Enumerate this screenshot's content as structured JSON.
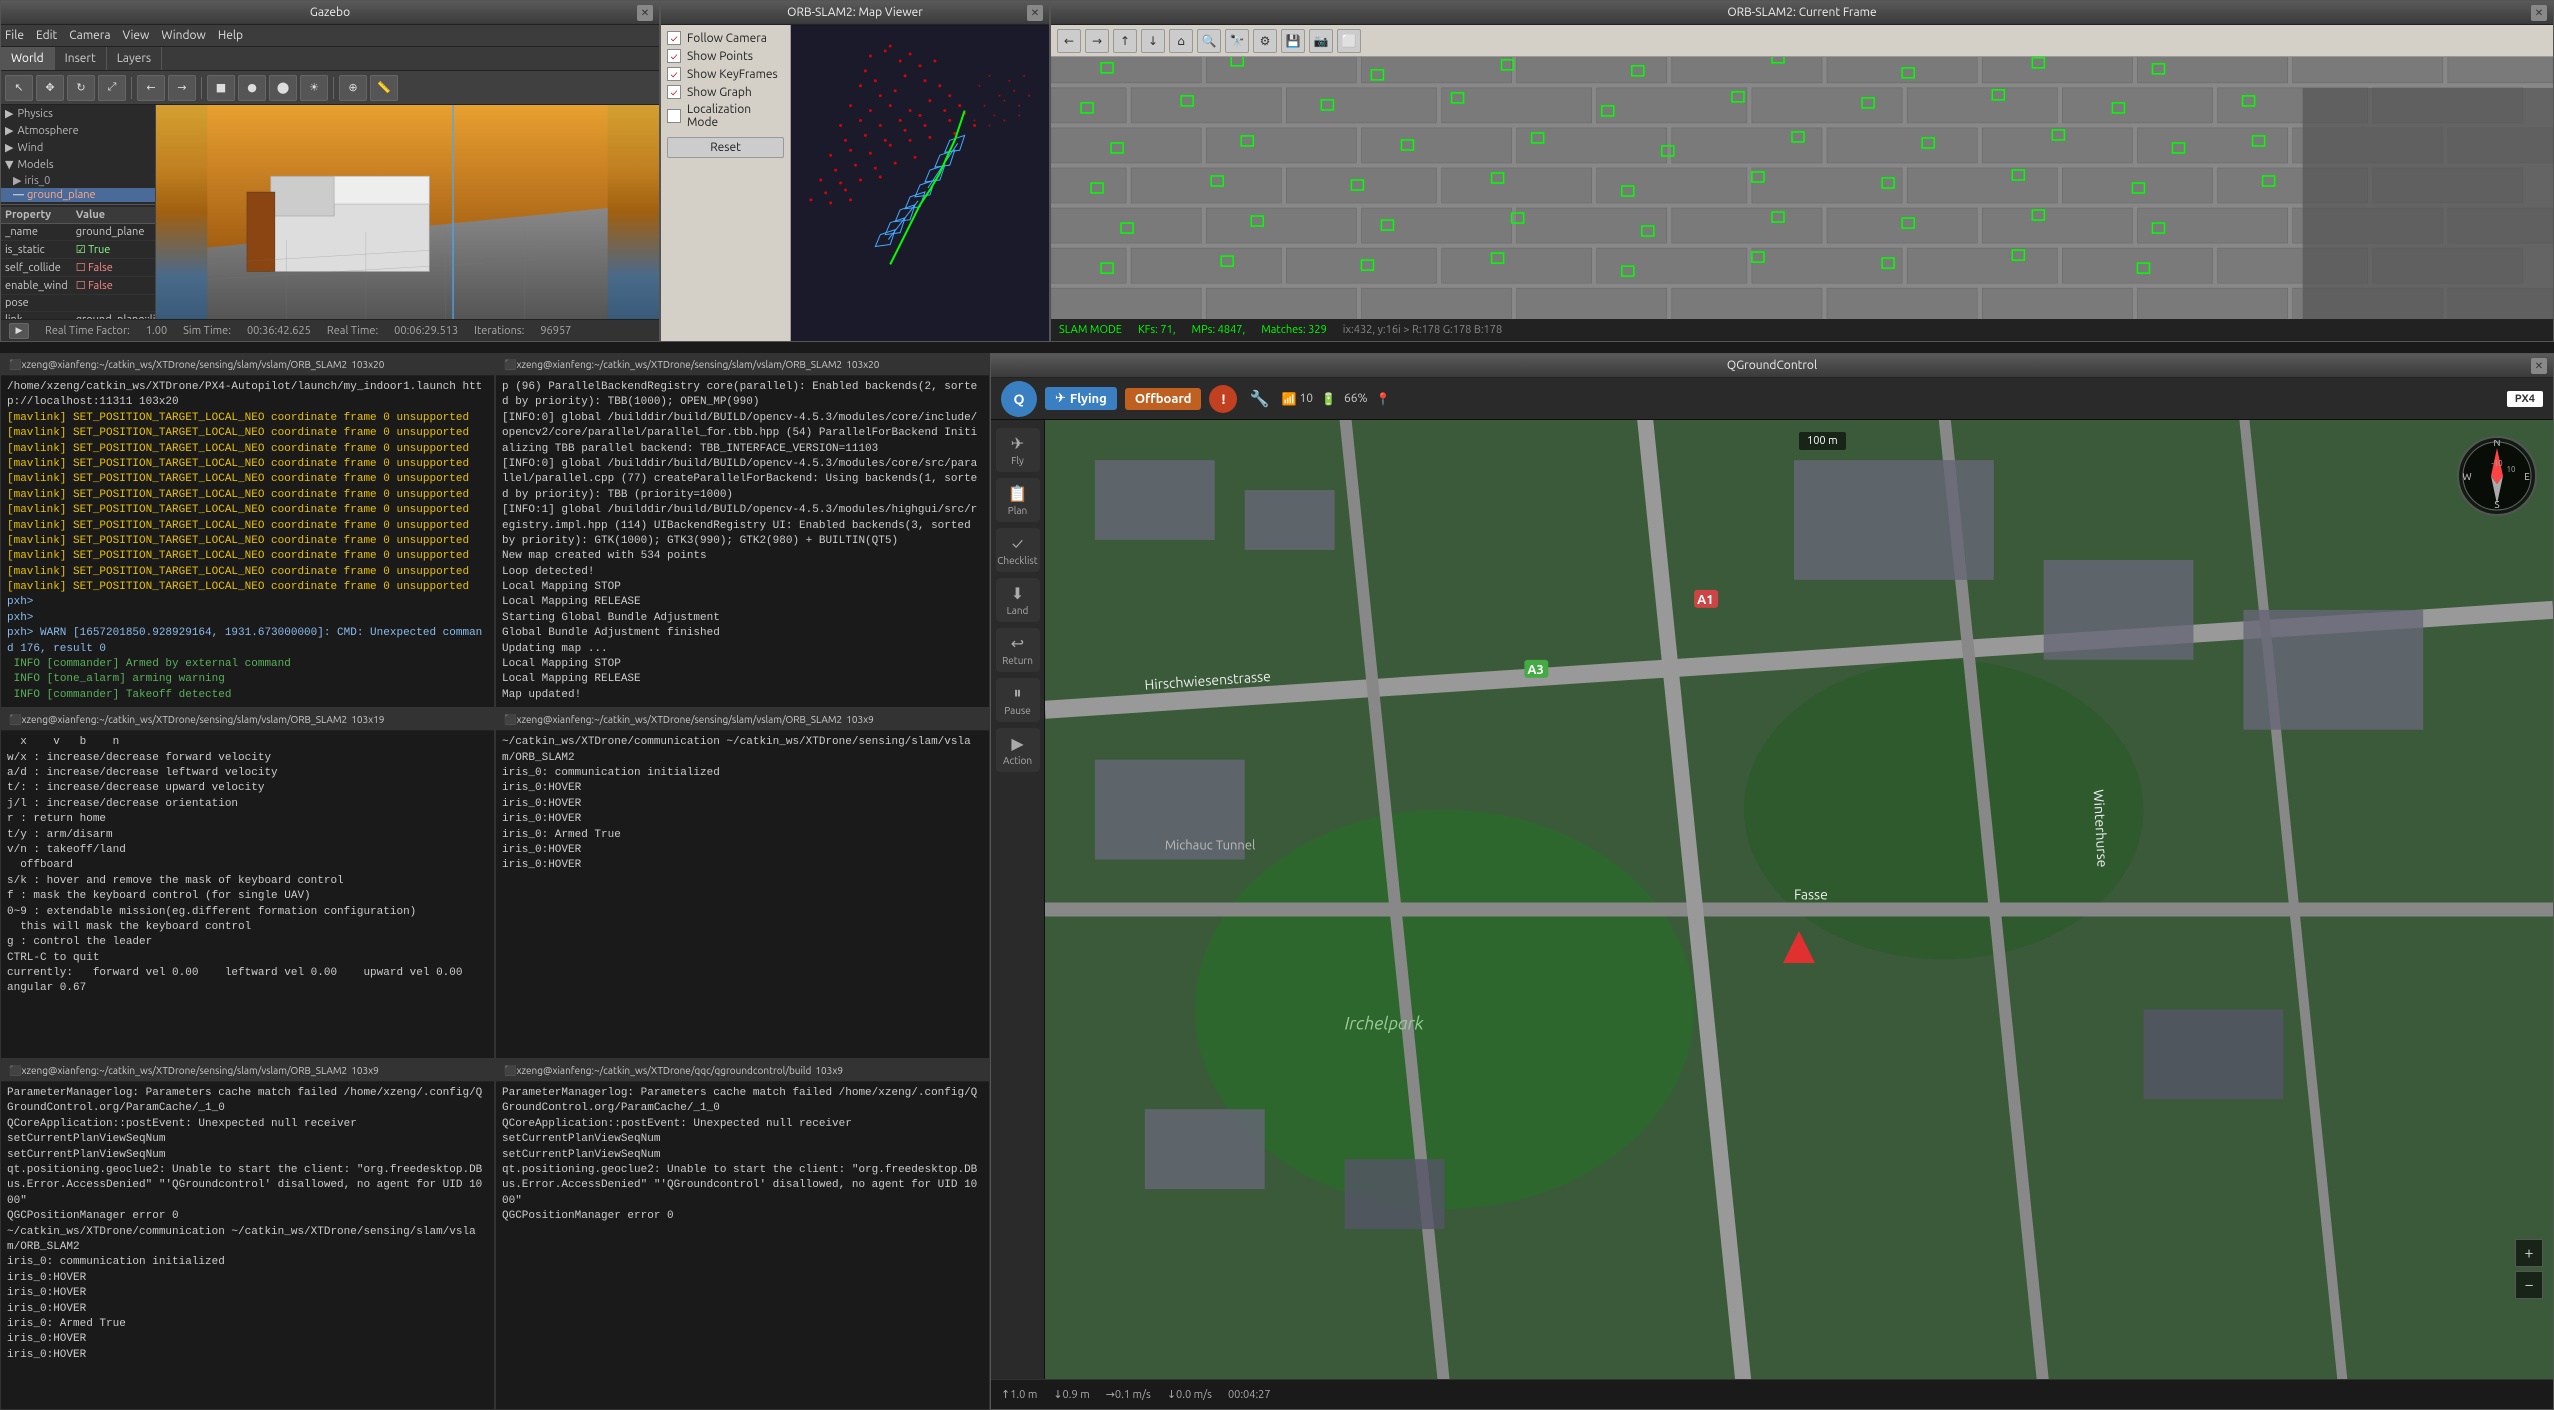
{
  "gazebo": {
    "title": "Gazebo",
    "menu": [
      "File",
      "Edit",
      "Camera",
      "View",
      "Window",
      "Help"
    ],
    "tabs": [
      "World",
      "Insert",
      "Layers"
    ],
    "active_tab": "World",
    "sidebar": {
      "sections": [
        {
          "label": "Physics",
          "expanded": false
        },
        {
          "label": "Atmosphere",
          "expanded": false
        },
        {
          "label": "Wind",
          "expanded": false
        },
        {
          "label": "Models",
          "expanded": true
        }
      ],
      "models": [
        {
          "label": "iris_0",
          "indent": 1
        },
        {
          "label": "ground_plane",
          "indent": 2,
          "selected": true
        }
      ]
    },
    "properties": {
      "headers": [
        "Property",
        "Value"
      ],
      "rows": [
        {
          "property": "_name",
          "value": "ground_plane"
        },
        {
          "property": "is_static",
          "value": "True"
        },
        {
          "property": "self_collide",
          "value": "False"
        },
        {
          "property": "enable_wind",
          "value": "False"
        },
        {
          "property": "pose",
          "value": ""
        },
        {
          "property": "link",
          "value": "ground_plane::link"
        }
      ]
    },
    "status": {
      "real_time_factor_label": "Real Time Factor:",
      "real_time_factor": "1.00",
      "sim_time_label": "Sim Time:",
      "sim_time": "00:36:42.625",
      "real_time_label": "Real Time:",
      "real_time": "00:06:29.513",
      "iterations_label": "Iterations:",
      "iterations": "96957"
    }
  },
  "orbslam_map": {
    "title": "ORB-SLAM2: Map Viewer",
    "checkboxes": [
      {
        "label": "Follow Camera",
        "checked": true
      },
      {
        "label": "Show Points",
        "checked": true
      },
      {
        "label": "Show KeyFrames",
        "checked": true
      },
      {
        "label": "Show Graph",
        "checked": true
      },
      {
        "label": "Localization Mode",
        "checked": false
      }
    ],
    "reset_label": "Reset"
  },
  "orbslam_frame": {
    "title": "ORB-SLAM2: Current Frame",
    "toolbar_buttons": [
      "←",
      "→",
      "↑",
      "↓",
      "⊡",
      "🔍+",
      "🔍-",
      "⚙",
      "💾",
      "📋",
      "🔲"
    ],
    "status": {
      "slam_mode": "SLAM MODE",
      "kfs": "KFs: 71,",
      "mps": "MPs: 4847,",
      "matches": "Matches: 329",
      "coords": "ix:432, y:16i > R:178 G:178 B:178"
    }
  },
  "terminals": [
    {
      "id": "term1",
      "title": "xzeng@xianfeng:~/catkin_ws/XTDrone/sensing/slam/vslam/ORB_SLAM2",
      "size": "103x20",
      "lines": [
        {
          "type": "normal",
          "text": "/home/xzeng/catkin_ws/XTDrone/PX4-Autopilot/launch/my_indoor1.launch http://localhost:11311 103x20"
        },
        {
          "type": "warn",
          "text": "[mavlink] SET_POSITION_TARGET_LOCAL_NEO coordinate frame 0 unsupported"
        },
        {
          "type": "warn",
          "text": "[mavlink] SET_POSITION_TARGET_LOCAL_NEO coordinate frame 0 unsupported"
        },
        {
          "type": "warn",
          "text": "[mavlink] SET_POSITION_TARGET_LOCAL_NEO coordinate frame 0 unsupported"
        },
        {
          "type": "warn",
          "text": "[mavlink] SET_POSITION_TARGET_LOCAL_NEO coordinate frame 0 unsupported"
        },
        {
          "type": "warn",
          "text": "[mavlink] SET_POSITION_TARGET_LOCAL_NEO coordinate frame 0 unsupported"
        },
        {
          "type": "warn",
          "text": "[mavlink] SET_POSITION_TARGET_LOCAL_NEO coordinate frame 0 unsupported"
        },
        {
          "type": "warn",
          "text": "[mavlink] SET_POSITION_TARGET_LOCAL_NEO coordinate frame 0 unsupported"
        },
        {
          "type": "warn",
          "text": "[mavlink] SET_POSITION_TARGET_LOCAL_NEO coordinate frame 0 unsupported"
        },
        {
          "type": "warn",
          "text": "[mavlink] SET_POSITION_TARGET_LOCAL_NEO coordinate frame 0 unsupported"
        },
        {
          "type": "warn",
          "text": "[mavlink] SET_POSITION_TARGET_LOCAL_NEO coordinate frame 0 unsupported"
        },
        {
          "type": "warn",
          "text": "[mavlink] SET_POSITION_TARGET_LOCAL_NEO coordinate frame 0 unsupported"
        },
        {
          "type": "warn",
          "text": "[mavlink] SET_POSITION_TARGET_LOCAL_NEO coordinate frame 0 unsupported"
        },
        {
          "type": "prompt",
          "text": "pxh>"
        },
        {
          "type": "prompt",
          "text": "pxh>"
        },
        {
          "type": "prompt",
          "text": "pxh> WARN [1657201850.928929164, 1931.673000000]: CMD: Unexpected command 176, result 0"
        },
        {
          "type": "info",
          "text": " INFO [commander] Armed by external command"
        },
        {
          "type": "info",
          "text": " INFO [tone_alarm] arming warning"
        },
        {
          "type": "info",
          "text": " INFO [commander] Takeoff detected"
        }
      ]
    },
    {
      "id": "term2",
      "title": "xzeng@xianfeng:~/catkin_ws/XTDrone/sensing/slam/vslam/ORB_SLAM2",
      "size": "103x20",
      "lines": [
        {
          "type": "normal",
          "text": "p (96) ParallelBackendRegistry core(parallel): Enabled backends(2, sorted by priority): TBB(1000); OPEN_MP(990)"
        },
        {
          "type": "normal",
          "text": "[INFO:0] global /builddir/build/BUILD/opencv-4.5.3/modules/core/include/opencv2/core/parallel/parallel_for.tbb.hpp (54) ParallelForBackend Initializing TBB parallel backend: TBB_INTERFACE_VERSION=11103"
        },
        {
          "type": "normal",
          "text": "[INFO:0] global /builddir/build/BUILD/opencv-4.5.3/modules/core/src/parallel/parallel.cpp (77) createParallelForBackend: Using backends(1, sorted by priority): TBB (priority=1000)"
        },
        {
          "type": "normal",
          "text": "[INFO:1] global /builddir/build/BUILD/opencv-4.5.3/modules/highgui/src/registry.impl.hpp (114) UIBackendRegistry UI: Enabled backends(3, sorted by priority): GTK(1000); GTK3(990); GTK2(980) + BUILTIN(QT5)"
        },
        {
          "type": "normal",
          "text": "New map created with 534 points"
        },
        {
          "type": "normal",
          "text": "Loop detected!"
        },
        {
          "type": "normal",
          "text": "Local Mapping STOP"
        },
        {
          "type": "normal",
          "text": "Local Mapping RELEASE"
        },
        {
          "type": "normal",
          "text": "Starting Global Bundle Adjustment"
        },
        {
          "type": "normal",
          "text": "Global Bundle Adjustment finished"
        },
        {
          "type": "normal",
          "text": "Updating map ..."
        },
        {
          "type": "normal",
          "text": "Local Mapping STOP"
        },
        {
          "type": "normal",
          "text": "Local Mapping RELEASE"
        },
        {
          "type": "normal",
          "text": "Map updated!"
        }
      ]
    },
    {
      "id": "term3",
      "title": "xzeng@xianfeng:~/catkin_ws/XTDrone/sensing/slam/vslam/ORB_SLAM2",
      "size": "103x19",
      "lines": [
        {
          "type": "normal",
          "text": "  x    v   b    n"
        },
        {
          "type": "normal",
          "text": "w/x : increase/decrease forward velocity"
        },
        {
          "type": "normal",
          "text": "a/d : increase/decrease leftward velocity"
        },
        {
          "type": "normal",
          "text": "t/: : increase/decrease upward velocity"
        },
        {
          "type": "normal",
          "text": "j/l : increase/decrease orientation"
        },
        {
          "type": "normal",
          "text": "r : return home"
        },
        {
          "type": "normal",
          "text": "t/y : arm/disarm"
        },
        {
          "type": "normal",
          "text": "v/n : takeoff/land"
        },
        {
          "type": "normal",
          "text": "  offboard"
        },
        {
          "type": "normal",
          "text": "s/k : hover and remove the mask of keyboard control"
        },
        {
          "type": "normal",
          "text": "f : mask the keyboard control (for single UAV)"
        },
        {
          "type": "normal",
          "text": "0~9 : extendable mission(eg.different formation configuration)"
        },
        {
          "type": "normal",
          "text": "  this will mask the keyboard control"
        },
        {
          "type": "normal",
          "text": "g : control the leader"
        },
        {
          "type": "normal",
          "text": "CTRL-C to quit"
        },
        {
          "type": "normal",
          "text": ""
        },
        {
          "type": "normal",
          "text": "currently:   forward vel 0.00    leftward vel 0.00    upward vel 0.00    angular 0.67"
        }
      ]
    },
    {
      "id": "term4",
      "title": "xzeng@xianfeng:~/catkin_ws/XTDrone/sensing/slam/vslam/ORB_SLAM2",
      "size": "103x9",
      "lines": [
        {
          "type": "normal",
          "text": "~/catkin_ws/XTDrone/communication ~/catkin_ws/XTDrone/sensing/slam/vslam/ORB_SLAM2"
        },
        {
          "type": "normal",
          "text": "iris_0: communication initialized"
        },
        {
          "type": "normal",
          "text": "iris_0:HOVER"
        },
        {
          "type": "normal",
          "text": "iris_0:HOVER"
        },
        {
          "type": "normal",
          "text": "iris_0:HOVER"
        },
        {
          "type": "normal",
          "text": "iris_0: Armed True"
        },
        {
          "type": "normal",
          "text": "iris_0:HOVER"
        },
        {
          "type": "normal",
          "text": "iris_0:HOVER"
        }
      ]
    },
    {
      "id": "term5",
      "title": "xzeng@xianfeng:~/catkin_ws/XTDrone/sensing/slam/vslam/ORB_SLAM2",
      "size": "103x9",
      "lines": [
        {
          "type": "normal",
          "text": "ParameterManagerlog: Parameters cache match failed /home/xzeng/.config/QGroundControl.org/ParamCache/_1_0"
        },
        {
          "type": "normal",
          "text": "QCoreApplication::postEvent: Unexpected null receiver"
        },
        {
          "type": "normal",
          "text": "setCurrentPlanViewSeqNum"
        },
        {
          "type": "normal",
          "text": "setCurrentPlanViewSeqNum"
        },
        {
          "type": "normal",
          "text": "qt.positioning.geoclue2: Unable to start the client: \"org.freedesktop.DBus.Error.AccessDenied\" \"'QGroundcontrol' disallowed, no agent for UID 1000\""
        },
        {
          "type": "normal",
          "text": "QGCPositionManager error 0"
        }
      ]
    }
  ],
  "qgroundcontrol": {
    "title": "QGroundControl",
    "mode": "Flying",
    "flight_mode": "Offboard",
    "warning": "!",
    "stats": {
      "signal": "10",
      "battery": "66%",
      "gps": "GPS"
    },
    "px4_label": "PX4",
    "sidebar_buttons": [
      "Fly",
      "Plan",
      "Checklist",
      "Land",
      "Return",
      "Pause",
      "Action"
    ],
    "map": {
      "scale": "100 m",
      "altitude": "↑1.0 m",
      "speed_down": "↓0.0 m/s",
      "speed_right": "→0.1 m/s",
      "time": "00:04:27"
    },
    "bottom_stats": [
      {
        "label": "↑1.0 m"
      },
      {
        "label": "↓0.9 m"
      },
      {
        "label": "→0.1 m/s"
      },
      {
        "label": "00:04:27"
      }
    ]
  }
}
